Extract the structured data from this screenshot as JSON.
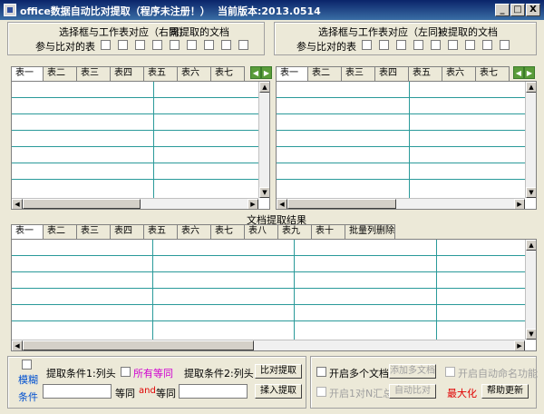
{
  "window": {
    "title": "office数据自动比对提取（程序未注册！）",
    "version": "当前版本:2013.0514",
    "minimize": "_",
    "maximize": "□",
    "close": "X"
  },
  "left_group": {
    "header_a": "选择框与工作表对应（右同）",
    "header_b": "需提取的文档",
    "compare_label": "参与比对的表"
  },
  "right_group": {
    "header_a": "选择框与工作表对应（左同）",
    "header_b": "被提取的文档",
    "compare_label": "参与比对的表"
  },
  "top_tabs": [
    "表一",
    "表二",
    "表三",
    "表四",
    "表五",
    "表六",
    "表七"
  ],
  "result": {
    "label": "文档提取结果",
    "tabs": [
      "表一",
      "表二",
      "表三",
      "表四",
      "表五",
      "表六",
      "表七",
      "表八",
      "表九",
      "表十",
      "批量列删除"
    ]
  },
  "bottom": {
    "fuzzy_label_1": "模糊",
    "fuzzy_label_2": "条件",
    "cond1_label": "提取条件1:列头",
    "all_equal_label": "所有等同",
    "cond2_label": "提取条件2:列头",
    "compare_extract_btn": "比对提取",
    "equal_label_1": "等同",
    "and_label": "and",
    "equal_label_2": "等同",
    "insert_extract_btn": "揉入提取",
    "multi_doc_label": "开启多个文档",
    "add_doc_btn": "添加多文档",
    "auto_name_label": "开启自动命名功能",
    "one_to_n_label": "开启1对N汇总",
    "auto_compare_btn": "自动比对",
    "maximize_label": "最大化",
    "help_btn": "帮助更新"
  },
  "colors": {
    "titlebar": "#0a246a",
    "grid_line": "#2a9a9a",
    "face": "#ece9d8",
    "accent_red": "#e00000",
    "accent_magenta": "#d000d0",
    "accent_blue": "#0050d0"
  }
}
